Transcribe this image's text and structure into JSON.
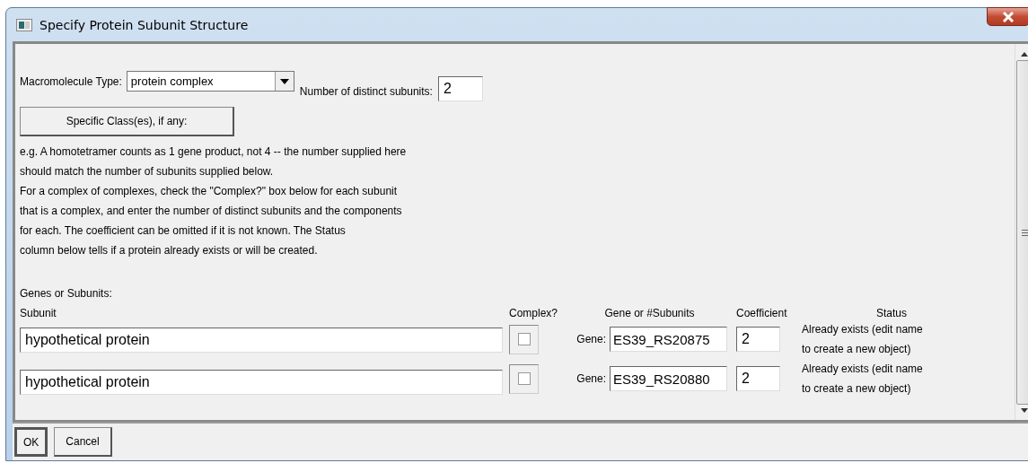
{
  "window": {
    "title": "Specify Protein Subunit Structure"
  },
  "macromolecule_type": {
    "label": "Macromolecule Type:",
    "value": "protein complex"
  },
  "distinct_subunits": {
    "label": "Number of distinct subunits:",
    "value": "2"
  },
  "class_button": "Specific Class(es), if any:",
  "help_lines": [
    "e.g. A homotetramer counts as 1 gene product, not 4 -- the number supplied here",
    "should match the number of subunits supplied below.",
    "For a complex of complexes, check the \"Complex?\" box below for each subunit",
    "that is a complex, and enter the number of distinct subunits and the components",
    "for each.  The coefficient can be omitted if it is not known.  The Status",
    "column below tells if a protein already exists or will be created."
  ],
  "section_label": "Genes or Subunits:",
  "columns": [
    "Subunit",
    "Complex?",
    "Gene or #Subunits",
    "Coefficient",
    "Status"
  ],
  "rows": [
    {
      "subunit": "hypothetical protein",
      "complex": false,
      "gene_label": "Gene:",
      "gene": "ES39_RS20875",
      "coefficient": "2",
      "status": [
        "Already exists (edit name",
        "to create a new object)"
      ]
    },
    {
      "subunit": "hypothetical protein",
      "complex": false,
      "gene_label": "Gene:",
      "gene": "ES39_RS20880",
      "coefficient": "2",
      "status": [
        "Already exists (edit name",
        "to create a new object)"
      ]
    }
  ],
  "buttons": [
    "OK",
    "Cancel"
  ]
}
